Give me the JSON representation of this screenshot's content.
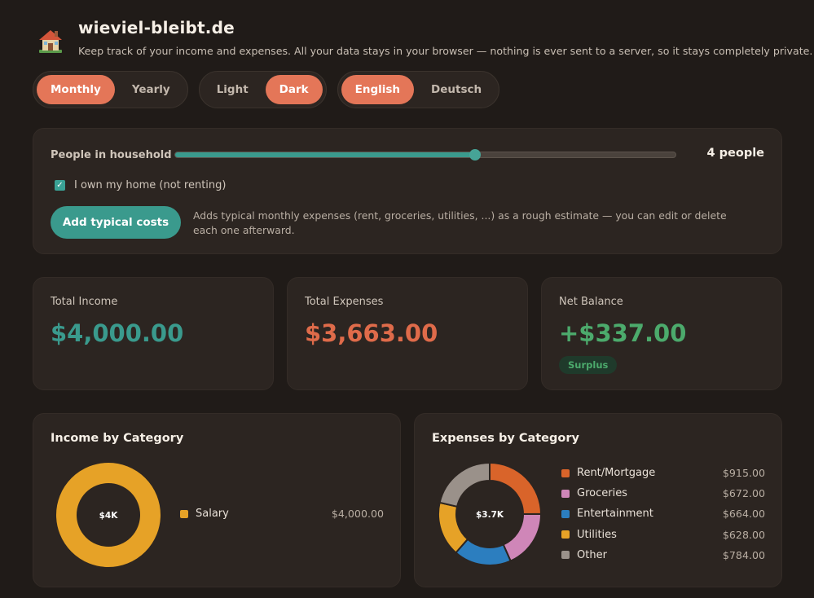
{
  "header": {
    "title": "wieviel-bleibt.de",
    "tagline": "Keep track of your income and expenses. All your data stays in your browser — nothing is ever sent to a server, so it stays completely private."
  },
  "toggles": {
    "period": {
      "options": [
        "Monthly",
        "Yearly"
      ],
      "active": "Monthly"
    },
    "theme": {
      "options": [
        "Light",
        "Dark"
      ],
      "active": "Dark"
    },
    "language": {
      "options": [
        "English",
        "Deutsch"
      ],
      "active": "English"
    }
  },
  "household": {
    "label": "People in household",
    "value_text": "4 people",
    "slider_fraction": 0.6,
    "own_home_label": "I own my home (not renting)",
    "own_home_checked": true,
    "add_button": "Add typical costs",
    "add_description": "Adds typical monthly expenses (rent, groceries, utilities, ...) as a rough estimate — you can edit or delete each one afterward."
  },
  "stats": {
    "income": {
      "label": "Total Income",
      "value": "$4,000.00"
    },
    "expenses": {
      "label": "Total Expenses",
      "value": "$3,663.00"
    },
    "net": {
      "label": "Net Balance",
      "value": "+$337.00",
      "badge": "Surplus"
    }
  },
  "colors": {
    "accent": "#e47658",
    "teal": "#3a9a8d",
    "expense": "#df6b4a",
    "surplus": "#4caa6c"
  },
  "chart_data": [
    {
      "type": "pie",
      "title": "Income by Category",
      "center_label": "$4K",
      "categories": [
        "Salary"
      ],
      "values": [
        4000
      ],
      "value_labels": [
        "$4,000.00"
      ],
      "colors": [
        "#e6a227"
      ]
    },
    {
      "type": "pie",
      "title": "Expenses by Category",
      "center_label": "$3.7K",
      "categories": [
        "Rent/Mortgage",
        "Groceries",
        "Entertainment",
        "Utilities",
        "Other"
      ],
      "values": [
        915,
        672,
        664,
        628,
        784
      ],
      "value_labels": [
        "$915.00",
        "$672.00",
        "$664.00",
        "$628.00",
        "$784.00"
      ],
      "colors": [
        "#d9642a",
        "#cf86b8",
        "#2c7ebf",
        "#e6a227",
        "#9a918a"
      ]
    }
  ]
}
